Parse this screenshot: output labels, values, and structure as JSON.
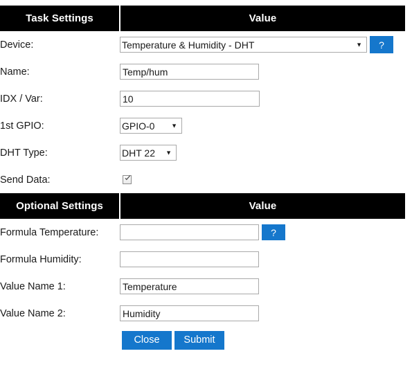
{
  "colors": {
    "header_bg": "#000000",
    "header_text": "#ffffff",
    "accent_blue": "#1577cc",
    "page_bg": "#ffffff",
    "field_border": "#a9a9a9"
  },
  "task_table": {
    "headers": {
      "setting": "Task Settings",
      "value": "Value"
    },
    "rows": [
      {
        "label": "Device:",
        "control": "select",
        "value": "Temperature & Humidity - DHT",
        "help": "?"
      },
      {
        "label": "Name:",
        "control": "text",
        "value": "Temp/hum",
        "placeholder": ""
      },
      {
        "label": "IDX / Var:",
        "control": "text",
        "value": "10",
        "placeholder": ""
      },
      {
        "label": "1st GPIO:",
        "control": "select",
        "value": "GPIO-0"
      },
      {
        "label": "DHT Type:",
        "control": "select",
        "value": "DHT 22"
      },
      {
        "label": "Send Data:",
        "control": "checkbox",
        "checked": true
      }
    ]
  },
  "optional_table": {
    "headers": {
      "setting": "Optional Settings",
      "value": "Value"
    },
    "rows": [
      {
        "label": "Formula Temperature:",
        "control": "text",
        "value": "",
        "placeholder": "",
        "help": "?"
      },
      {
        "label": "Formula Humidity:",
        "control": "text",
        "value": "",
        "placeholder": ""
      },
      {
        "label": "Value Name 1:",
        "control": "text",
        "value": "Temperature",
        "placeholder": ""
      },
      {
        "label": "Value Name 2:",
        "control": "text",
        "value": "Humidity",
        "placeholder": ""
      }
    ]
  },
  "actions": {
    "close_label": "Close",
    "submit_label": "Submit"
  },
  "icons": {
    "dropdown_caret": "▼",
    "check_mark": "check-icon",
    "help": "question-mark-icon"
  }
}
